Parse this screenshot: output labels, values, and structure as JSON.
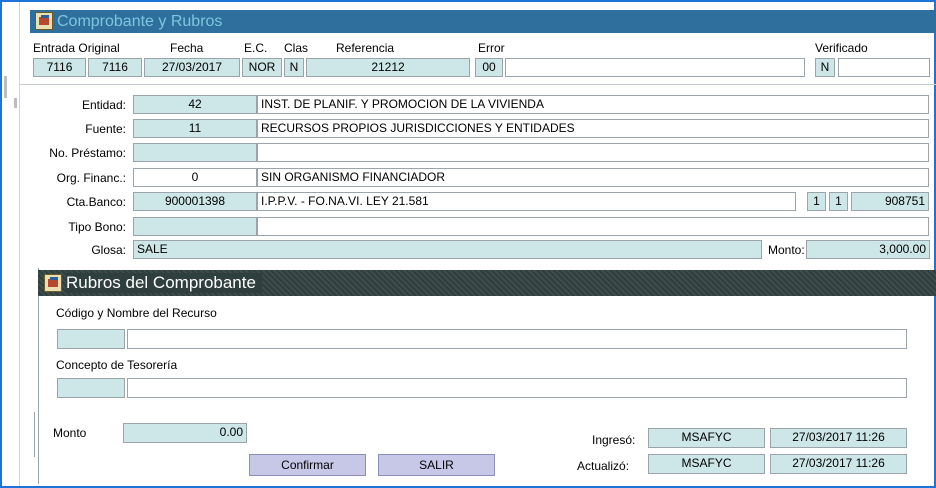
{
  "window": {
    "title": "Comprobante y Rubros",
    "title_color": "#7cc7dd",
    "frame_color": "#1e73d8"
  },
  "header": {
    "labels": {
      "entrada_original": "Entrada Original",
      "fecha": "Fecha",
      "ec": "E.C.",
      "clas": "Clas",
      "referencia": "Referencia",
      "error": "Error",
      "verificado": "Verificado"
    },
    "values": {
      "entrada": "7116",
      "original": "7116",
      "fecha": "27/03/2017",
      "ec": "NOR",
      "clas": "N",
      "referencia": "21212",
      "error_code": "00",
      "error_text": "",
      "verificado_flag": "N",
      "verificado_text": ""
    }
  },
  "details": {
    "entidad": {
      "label": "Entidad:",
      "code": "42",
      "name": "INST. DE PLANIF. Y PROMOCION DE LA VIVIENDA"
    },
    "fuente": {
      "label": "Fuente:",
      "code": "11",
      "name": "RECURSOS PROPIOS JURISDICCIONES Y ENTIDADES"
    },
    "prestamo": {
      "label": "No. Préstamo:",
      "code": "",
      "name": ""
    },
    "org_financ": {
      "label": "Org. Financ.:",
      "code": "0",
      "name": "SIN ORGANISMO FINANCIADOR"
    },
    "cta_banco": {
      "label": "Cta.Banco:",
      "code": "900001398",
      "name": "I.P.P.V. - FO.NA.VI. LEY 21.581",
      "extra1": "1",
      "extra2": "1",
      "extra3": "908751"
    },
    "tipo_bono": {
      "label": "Tipo Bono:",
      "code": "",
      "name": ""
    },
    "glosa": {
      "label": "Glosa:",
      "value": "SALE"
    },
    "monto": {
      "label": "Monto:",
      "value": "3,000.00"
    }
  },
  "rubros": {
    "title": "Rubros del Comprobante",
    "header_color": "#2f3f3d",
    "codigo_label": "Código y Nombre del Recurso",
    "codigo_value": "",
    "codigo_name": "",
    "concepto_label": "Concepto de Tesorería",
    "concepto_value": "",
    "concepto_name": "",
    "monto_label": "Monto",
    "monto_value": "0.00",
    "confirmar_label": "Confirmar",
    "salir_label": "SALIR",
    "ingreso_label": "Ingresó:",
    "ingreso_user": "MSAFYC",
    "ingreso_date": "27/03/2017 11:26",
    "actualizo_label": "Actualizó:",
    "actualizo_user": "MSAFYC",
    "actualizo_date": "27/03/2017 11:26"
  }
}
